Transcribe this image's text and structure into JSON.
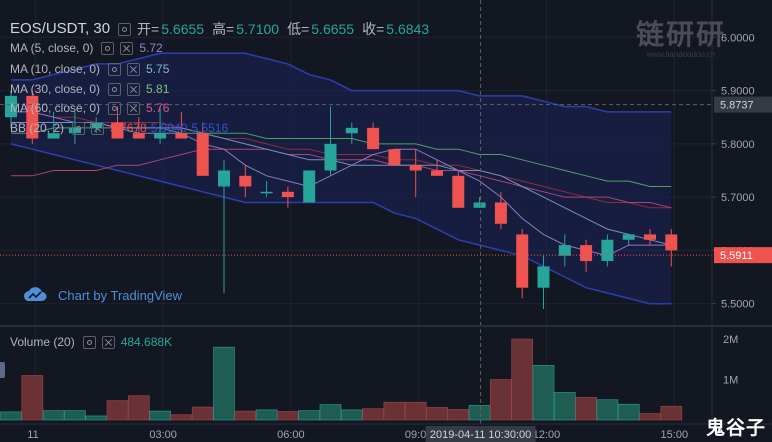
{
  "symbol": {
    "pair": "EOS/USDT",
    "interval": "30",
    "open_label": "开=",
    "open": "5.6655",
    "high_label": "高=",
    "high": "5.7100",
    "low_label": "低=",
    "low": "5.6655",
    "close_label": "收=",
    "close": "5.6843",
    "separator": ","
  },
  "indicators": [
    {
      "name": "MA (5, close, 0)",
      "values": [
        "5.72"
      ],
      "colors": [
        "#9a7fd1"
      ]
    },
    {
      "name": "MA (10, close, 0)",
      "values": [
        "5.75"
      ],
      "colors": [
        "#7fb3d8"
      ]
    },
    {
      "name": "MA (30, close, 0)",
      "values": [
        "5.81"
      ],
      "colors": [
        "#7bc67e"
      ]
    },
    {
      "name": "MA (60, close, 0)",
      "values": [
        "5.76"
      ],
      "colors": [
        "#d1578f"
      ]
    },
    {
      "name": "BB (20, 2)",
      "values": [
        "5.7678",
        "5.9840",
        "5.5516"
      ],
      "colors": [
        "#ef5350",
        "#3454d1",
        "#3454d1"
      ]
    }
  ],
  "volume": {
    "name": "Volume (20)",
    "value": "484.688K",
    "value_color": "#26a69a"
  },
  "tradingview_badge": "Chart by TradingView",
  "watermark": {
    "text": "链研研",
    "sub": "www.liandoodoo.cn"
  },
  "signature": "鬼谷子",
  "crosshair_time": "2019-04-11 10:30:00",
  "colors": {
    "up": "#26a69a",
    "down": "#ef5350",
    "background": "#131722",
    "bb_fill": "#1c2257"
  },
  "chart_data": {
    "type": "candlestick",
    "price_axis": {
      "ticks": [
        6.0,
        5.9,
        5.8,
        5.7,
        5.6,
        5.5
      ],
      "tick_labels": [
        "6.0000",
        "5.9000",
        "5.8000",
        "5.7000",
        "5.6000",
        "5.5000"
      ],
      "range": [
        5.46,
        6.07
      ]
    },
    "volume_axis": {
      "ticks": [
        2000000,
        1000000
      ],
      "tick_labels": [
        "2M",
        "1M"
      ]
    },
    "time_axis": {
      "labels": [
        "11",
        "03:00",
        "06:00",
        "09:00",
        "12:00",
        "15:00"
      ],
      "label_indices": [
        1,
        7,
        13,
        19,
        25,
        31
      ]
    },
    "last_price": {
      "value": "5.5911",
      "color": "#ef5350"
    },
    "crosshair_price": {
      "value": "5.8737"
    },
    "candles": [
      {
        "o": 5.85,
        "h": 5.9,
        "l": 5.83,
        "c": 5.89
      },
      {
        "o": 5.89,
        "h": 5.9,
        "l": 5.8,
        "c": 5.81
      },
      {
        "o": 5.81,
        "h": 5.86,
        "l": 5.81,
        "c": 5.82
      },
      {
        "o": 5.82,
        "h": 5.86,
        "l": 5.8,
        "c": 5.83
      },
      {
        "o": 5.83,
        "h": 5.85,
        "l": 5.82,
        "c": 5.84
      },
      {
        "o": 5.84,
        "h": 5.87,
        "l": 5.81,
        "c": 5.81
      },
      {
        "o": 5.82,
        "h": 5.85,
        "l": 5.81,
        "c": 5.81
      },
      {
        "o": 5.81,
        "h": 5.87,
        "l": 5.8,
        "c": 5.82
      },
      {
        "o": 5.82,
        "h": 5.86,
        "l": 5.81,
        "c": 5.81
      },
      {
        "o": 5.82,
        "h": 5.84,
        "l": 5.74,
        "c": 5.74
      },
      {
        "o": 5.72,
        "h": 5.77,
        "l": 5.52,
        "c": 5.75
      },
      {
        "o": 5.74,
        "h": 5.76,
        "l": 5.7,
        "c": 5.72
      },
      {
        "o": 5.71,
        "h": 5.73,
        "l": 5.7,
        "c": 5.71
      },
      {
        "o": 5.71,
        "h": 5.72,
        "l": 5.68,
        "c": 5.7
      },
      {
        "o": 5.69,
        "h": 5.74,
        "l": 5.69,
        "c": 5.75
      },
      {
        "o": 5.75,
        "h": 5.87,
        "l": 5.74,
        "c": 5.8
      },
      {
        "o": 5.82,
        "h": 5.84,
        "l": 5.8,
        "c": 5.83
      },
      {
        "o": 5.83,
        "h": 5.84,
        "l": 5.79,
        "c": 5.79
      },
      {
        "o": 5.79,
        "h": 5.79,
        "l": 5.76,
        "c": 5.76
      },
      {
        "o": 5.76,
        "h": 5.79,
        "l": 5.7,
        "c": 5.75
      },
      {
        "o": 5.75,
        "h": 5.77,
        "l": 5.74,
        "c": 5.74
      },
      {
        "o": 5.74,
        "h": 5.75,
        "l": 5.68,
        "c": 5.68
      },
      {
        "o": 5.68,
        "h": 5.7,
        "l": 5.68,
        "c": 5.69
      },
      {
        "o": 5.69,
        "h": 5.71,
        "l": 5.64,
        "c": 5.65
      },
      {
        "o": 5.63,
        "h": 5.64,
        "l": 5.51,
        "c": 5.53
      },
      {
        "o": 5.53,
        "h": 5.59,
        "l": 5.49,
        "c": 5.57
      },
      {
        "o": 5.59,
        "h": 5.63,
        "l": 5.57,
        "c": 5.61
      },
      {
        "o": 5.61,
        "h": 5.62,
        "l": 5.56,
        "c": 5.58
      },
      {
        "o": 5.58,
        "h": 5.63,
        "l": 5.57,
        "c": 5.62
      },
      {
        "o": 5.62,
        "h": 5.63,
        "l": 5.61,
        "c": 5.63
      },
      {
        "o": 5.63,
        "h": 5.64,
        "l": 5.61,
        "c": 5.62
      },
      {
        "o": 5.63,
        "h": 5.64,
        "l": 5.57,
        "c": 5.6
      }
    ],
    "volumes": [
      200000,
      1100000,
      230000,
      230000,
      100000,
      480000,
      600000,
      220000,
      130000,
      320000,
      1800000,
      220000,
      250000,
      210000,
      230000,
      380000,
      250000,
      280000,
      440000,
      440000,
      310000,
      260000,
      360000,
      1000000,
      2000000,
      1350000,
      680000,
      560000,
      500000,
      390000,
      160000,
      340000
    ],
    "ma5": [
      5.86,
      5.86,
      5.85,
      5.84,
      5.84,
      5.83,
      5.82,
      5.82,
      5.82,
      5.8,
      5.79,
      5.76,
      5.74,
      5.73,
      5.72,
      5.74,
      5.76,
      5.78,
      5.79,
      5.79,
      5.77,
      5.75,
      5.73,
      5.7,
      5.66,
      5.63,
      5.61,
      5.6,
      5.59,
      5.61,
      5.61,
      5.61
    ],
    "ma10": [
      5.84,
      5.84,
      5.84,
      5.84,
      5.84,
      5.83,
      5.83,
      5.83,
      5.83,
      5.82,
      5.81,
      5.8,
      5.79,
      5.78,
      5.77,
      5.77,
      5.76,
      5.76,
      5.76,
      5.76,
      5.76,
      5.75,
      5.75,
      5.74,
      5.72,
      5.7,
      5.68,
      5.66,
      5.64,
      5.63,
      5.62,
      5.61
    ],
    "ma30": [
      5.82,
      5.82,
      5.83,
      5.83,
      5.83,
      5.83,
      5.83,
      5.83,
      5.82,
      5.82,
      5.82,
      5.82,
      5.81,
      5.81,
      5.81,
      5.81,
      5.81,
      5.8,
      5.8,
      5.8,
      5.79,
      5.79,
      5.78,
      5.78,
      5.77,
      5.76,
      5.75,
      5.74,
      5.73,
      5.73,
      5.72,
      5.72
    ],
    "ma60": [
      5.74,
      5.74,
      5.75,
      5.75,
      5.75,
      5.76,
      5.76,
      5.77,
      5.78,
      5.79,
      5.79,
      5.79,
      5.79,
      5.78,
      5.78,
      5.77,
      5.77,
      5.77,
      5.76,
      5.76,
      5.75,
      5.75,
      5.74,
      5.73,
      5.72,
      5.71,
      5.7,
      5.7,
      5.7,
      5.69,
      5.69,
      5.68
    ],
    "bb_upper": [
      5.92,
      5.92,
      5.93,
      5.94,
      5.95,
      5.95,
      5.96,
      5.97,
      5.97,
      5.97,
      5.97,
      5.97,
      5.96,
      5.95,
      5.93,
      5.92,
      5.9,
      5.9,
      5.9,
      5.9,
      5.9,
      5.9,
      5.89,
      5.89,
      5.89,
      5.88,
      5.87,
      5.87,
      5.86,
      5.86,
      5.86,
      5.86
    ],
    "bb_middle": [
      5.86,
      5.86,
      5.85,
      5.85,
      5.84,
      5.84,
      5.84,
      5.84,
      5.83,
      5.82,
      5.81,
      5.81,
      5.8,
      5.79,
      5.79,
      5.78,
      5.78,
      5.78,
      5.77,
      5.77,
      5.76,
      5.76,
      5.75,
      5.74,
      5.73,
      5.72,
      5.71,
      5.7,
      5.69,
      5.69,
      5.68,
      5.68
    ],
    "bb_lower": [
      5.8,
      5.79,
      5.78,
      5.77,
      5.76,
      5.75,
      5.74,
      5.73,
      5.72,
      5.71,
      5.7,
      5.69,
      5.69,
      5.69,
      5.69,
      5.69,
      5.69,
      5.69,
      5.67,
      5.66,
      5.64,
      5.62,
      5.61,
      5.6,
      5.59,
      5.57,
      5.55,
      5.53,
      5.52,
      5.51,
      5.5,
      5.5
    ]
  }
}
